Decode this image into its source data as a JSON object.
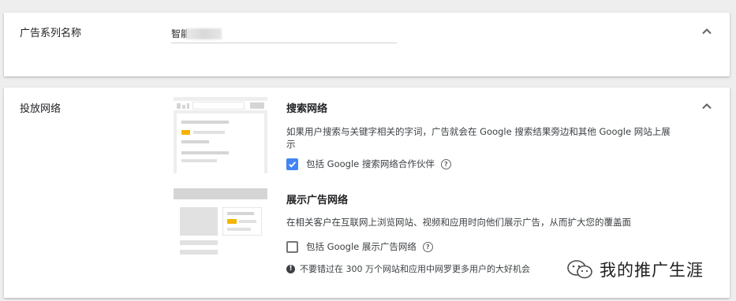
{
  "campaign_name": {
    "label": "广告系列名称",
    "value": "智能"
  },
  "networks": {
    "label": "投放网络",
    "search": {
      "heading": "搜索网络",
      "description": "如果用户搜索与关键字相关的字词，广告就会在 Google 搜索结果旁边和其他 Google 网站上展示",
      "checkbox_label": "包括 Google 搜索网络合作伙伴",
      "checked": true
    },
    "display": {
      "heading": "展示广告网络",
      "description": "在相关客户在互联网上浏览网站、视频和应用时向他们展示广告，从而扩大您的覆盖面",
      "checkbox_label": "包括 Google 展示广告网络",
      "checked": false,
      "warning": "不要错过在 300 万个网站和应用中网罗更多用户的大好机会"
    }
  },
  "watermark": {
    "text": "我的推广生涯"
  },
  "colors": {
    "accent": "#4285f4",
    "highlight": "#f5b400"
  },
  "icons": {
    "collapse": "chevron-up-icon",
    "help": "help-circle-icon",
    "warning": "info-circle-icon",
    "watermark": "wechat-logo-icon"
  }
}
